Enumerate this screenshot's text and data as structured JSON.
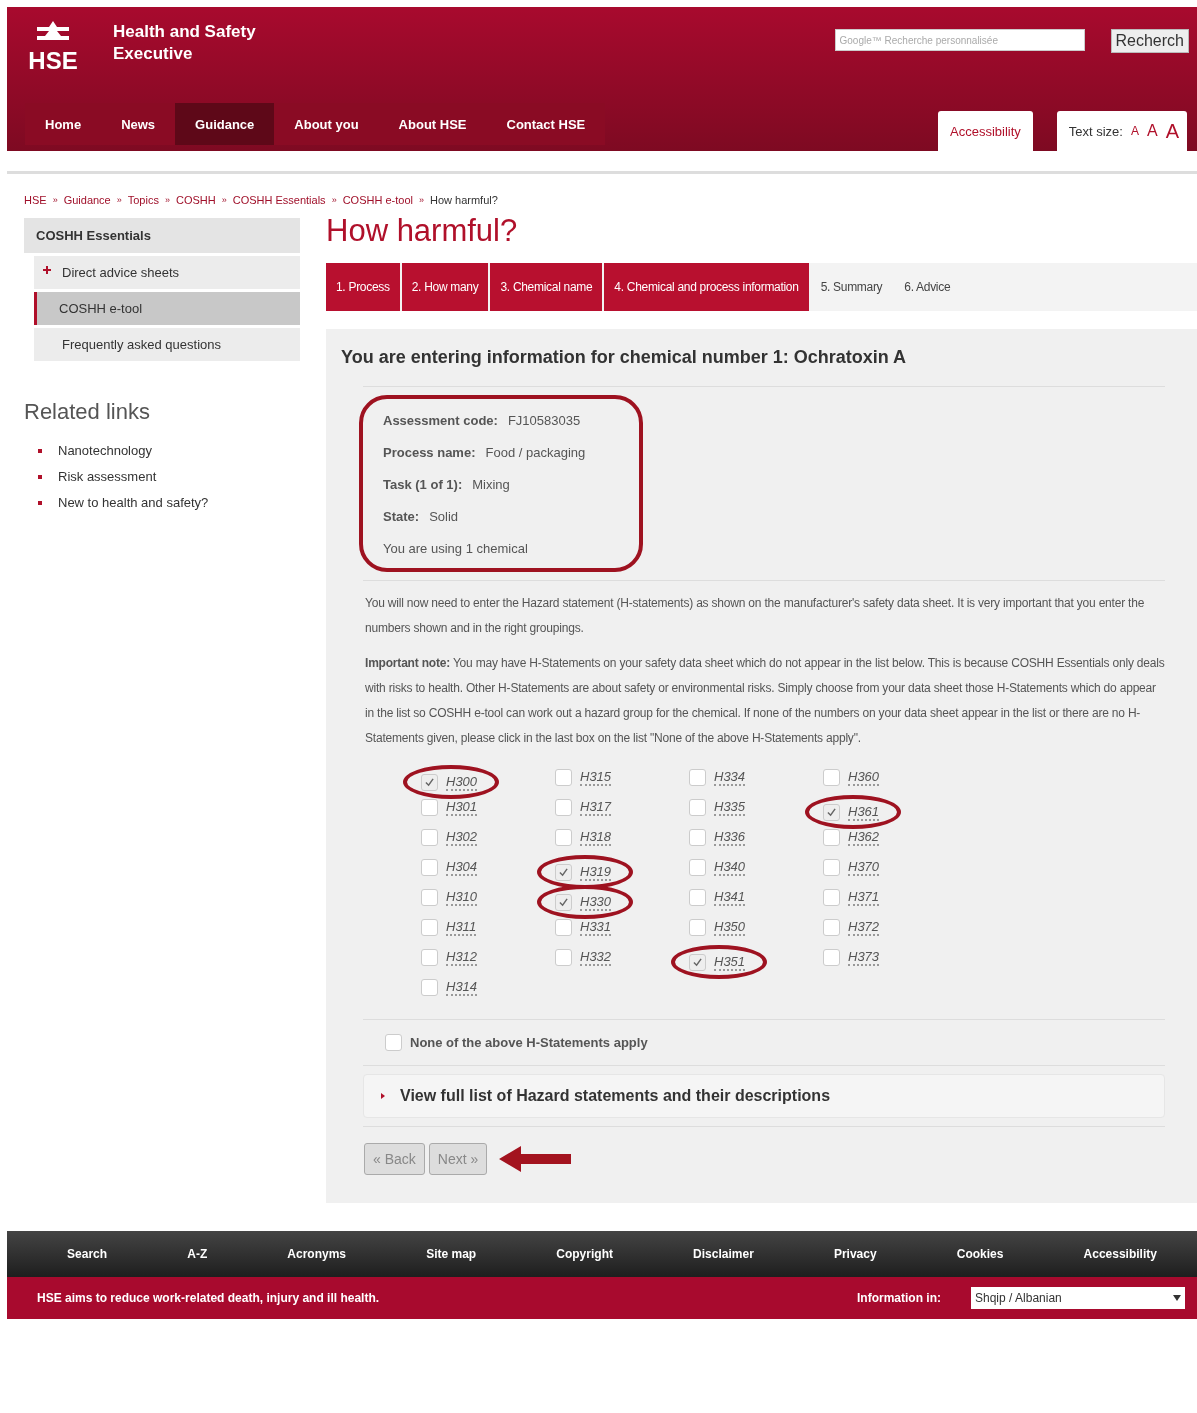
{
  "header": {
    "logo_text": "HSE",
    "org_name": "Health and Safety Executive",
    "search": {
      "placeholder": "Google™ Recherche personnalisée"
    },
    "search_button": "Recherch"
  },
  "nav": [
    {
      "label": "Home",
      "selected": false
    },
    {
      "label": "News",
      "selected": false
    },
    {
      "label": "Guidance",
      "selected": true
    },
    {
      "label": "About you",
      "selected": false
    },
    {
      "label": "About HSE",
      "selected": false
    },
    {
      "label": "Contact HSE",
      "selected": false
    }
  ],
  "accessibility_tab": "Accessibility",
  "text_size": {
    "label": "Text size:",
    "sizes": [
      "A",
      "A",
      "A"
    ]
  },
  "breadcrumb_separator": "»",
  "breadcrumb": [
    "HSE",
    "Guidance",
    "Topics",
    "COSHH",
    "COSHH Essentials",
    "COSHH e-tool",
    "How harmful?"
  ],
  "sidebar": {
    "heading": "COSHH Essentials",
    "items": [
      {
        "label": "Direct advice sheets",
        "expandable": true,
        "selected": false
      },
      {
        "label": "COSHH e-tool",
        "expandable": false,
        "selected": true
      },
      {
        "label": "Frequently asked questions",
        "expandable": false,
        "selected": false
      }
    ]
  },
  "related_links": {
    "heading": "Related links",
    "items": [
      "Nanotechnology",
      "Risk assessment",
      "New to health and safety?"
    ]
  },
  "page_title": "How harmful?",
  "steps": [
    {
      "label": "1. Process",
      "done": true
    },
    {
      "label": "2. How many",
      "done": true
    },
    {
      "label": "3. Chemical name",
      "done": true
    },
    {
      "label": "4. Chemical and process information",
      "done": true
    },
    {
      "label": "5. Summary",
      "done": false
    },
    {
      "label": "6. Advice",
      "done": false
    }
  ],
  "panel": {
    "heading": "You are entering information for chemical number 1: Ochratoxin A",
    "summary": {
      "circled": true,
      "fields": [
        {
          "label": "Assessment code:",
          "value": "FJ10583035"
        },
        {
          "label": "Process name:",
          "value": "Food / packaging"
        },
        {
          "label": "Task (1 of 1):",
          "value": "Mixing"
        },
        {
          "label": "State:",
          "value": "Solid"
        }
      ],
      "note": "You are using 1 chemical"
    },
    "intro": "You will now need to enter the Hazard statement (H-statements) as shown on the manufacturer's safety data sheet. It is very important that you enter the numbers shown and in the right groupings.",
    "important_note": "**Important note:** You may have H-Statements on your safety data sheet which do not appear in the list below. This is because COSHH Essentials only deals with risks to health. Other H-Statements are about safety or environmental risks. Simply choose from your data sheet those H-Statements which do appear in the list so COSHH e-tool can work out a hazard group for the chemical. If none of the numbers on your data sheet appear in the list or there are no H-Statements given, please click in the last box on the list \"None of the above H-Statements apply\".",
    "statements": [
      {
        "code": "H300",
        "checked": true,
        "circled": true
      },
      {
        "code": "H301",
        "checked": false,
        "circled": false
      },
      {
        "code": "H302",
        "checked": false,
        "circled": false
      },
      {
        "code": "H304",
        "checked": false,
        "circled": false
      },
      {
        "code": "H310",
        "checked": false,
        "circled": false
      },
      {
        "code": "H311",
        "checked": false,
        "circled": false
      },
      {
        "code": "H312",
        "checked": false,
        "circled": false
      },
      {
        "code": "H314",
        "checked": false,
        "circled": false
      },
      {
        "code": "H315",
        "checked": false,
        "circled": false
      },
      {
        "code": "H317",
        "checked": false,
        "circled": false
      },
      {
        "code": "H318",
        "checked": false,
        "circled": false
      },
      {
        "code": "H319",
        "checked": true,
        "circled": true
      },
      {
        "code": "H330",
        "checked": true,
        "circled": true
      },
      {
        "code": "H331",
        "checked": false,
        "circled": false
      },
      {
        "code": "H332",
        "checked": false,
        "circled": false
      },
      {
        "code": "H334",
        "checked": false,
        "circled": false
      },
      {
        "code": "H335",
        "checked": false,
        "circled": false
      },
      {
        "code": "H336",
        "checked": false,
        "circled": false
      },
      {
        "code": "H340",
        "checked": false,
        "circled": false
      },
      {
        "code": "H341",
        "checked": false,
        "circled": false
      },
      {
        "code": "H350",
        "checked": false,
        "circled": false
      },
      {
        "code": "H351",
        "checked": true,
        "circled": true
      },
      {
        "code": "H360",
        "checked": false,
        "circled": false
      },
      {
        "code": "H361",
        "checked": true,
        "circled": true
      },
      {
        "code": "H362",
        "checked": false,
        "circled": false
      },
      {
        "code": "H370",
        "checked": false,
        "circled": false
      },
      {
        "code": "H371",
        "checked": false,
        "circled": false
      },
      {
        "code": "H372",
        "checked": false,
        "circled": false
      },
      {
        "code": "H373",
        "checked": false,
        "circled": false
      }
    ],
    "none_option": {
      "label": "None of the above H-Statements apply",
      "checked": false
    },
    "expander": {
      "label": "View full list of Hazard statements and their descriptions",
      "expanded": false
    },
    "buttons": [
      {
        "label": "« Back"
      },
      {
        "label": "Next »"
      }
    ]
  },
  "footer": {
    "links": [
      "Search",
      "A-Z",
      "Acronyms",
      "Site map",
      "Copyright",
      "Disclaimer",
      "Privacy",
      "Cookies",
      "Accessibility"
    ],
    "tagline": "HSE aims to reduce work-related death, injury and ill health.",
    "language_label": "Information in:",
    "language": {
      "value": "Shqip / Albanian"
    }
  }
}
